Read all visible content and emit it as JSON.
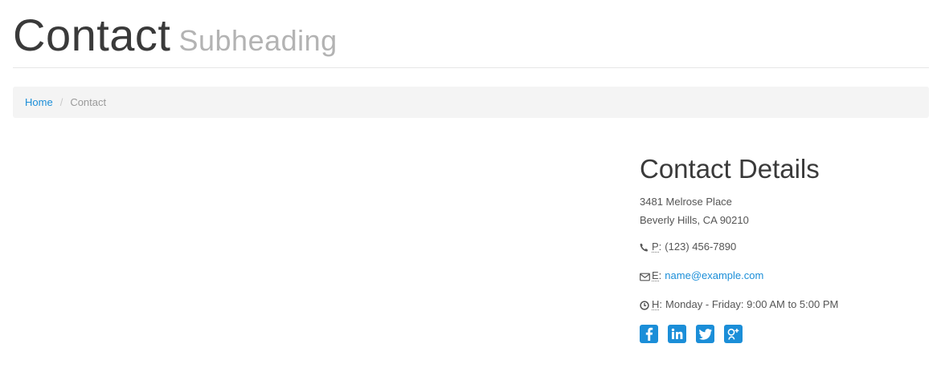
{
  "header": {
    "title": "Contact",
    "subtitle": "Subheading"
  },
  "breadcrumb": {
    "home_label": "Home",
    "separator": "/",
    "current_label": "Contact"
  },
  "contact_details": {
    "heading": "Contact Details",
    "address_line1": "3481 Melrose Place",
    "address_line2": "Beverly Hills, CA 90210",
    "phone_label": "P",
    "phone_value": "(123) 456-7890",
    "email_label": "E",
    "email_value": "name@example.com",
    "hours_label": "H",
    "hours_value": "Monday - Friday: 9:00 AM to 5:00 PM"
  },
  "icons": {
    "phone": "phone-icon",
    "email": "envelope-icon",
    "hours": "clock-icon"
  },
  "social": [
    {
      "icon": "facebook-icon"
    },
    {
      "icon": "linkedin-icon"
    },
    {
      "icon": "twitter-icon"
    },
    {
      "icon": "google-plus-icon"
    }
  ],
  "colors": {
    "accent": "#1b8ed8",
    "title": "#3a3a3a",
    "subtitle": "#b3b3b3",
    "breadcrumb_bg": "#f4f4f4"
  }
}
